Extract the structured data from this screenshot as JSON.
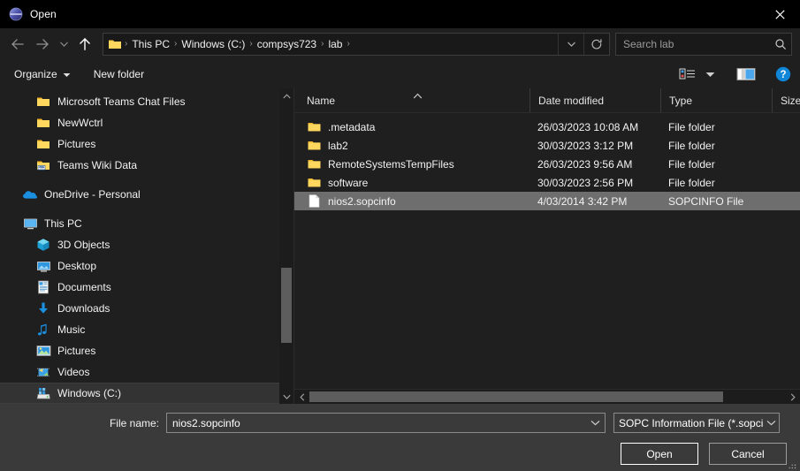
{
  "window": {
    "title": "Open",
    "icon": "quartus-sphere-icon",
    "close_label": "✕"
  },
  "nav": {
    "back": "back-arrow",
    "forward": "forward-arrow",
    "recent": "recent-locations-chevron",
    "up": "up-arrow",
    "breadcrumbs": [
      "This PC",
      "Windows (C:)",
      "compsys723",
      "lab"
    ],
    "separator": "›",
    "history_dropdown": "chevron-down",
    "refresh": "refresh-icon"
  },
  "search": {
    "placeholder": "Search lab"
  },
  "toolbar": {
    "organize_label": "Organize",
    "organize_caret": "▾",
    "new_folder_label": "New folder",
    "view_label": "Change your view",
    "view_caret": "▾",
    "preview_label": "Show the preview pane",
    "help_label": "?"
  },
  "sidebar": {
    "items": [
      {
        "label": "Microsoft Teams Chat Files",
        "icon": "folder-icon",
        "indent": 2,
        "selected": false
      },
      {
        "label": "NewWctrl",
        "icon": "folder-icon",
        "indent": 2,
        "selected": false
      },
      {
        "label": "Pictures",
        "icon": "folder-icon",
        "indent": 2,
        "selected": false
      },
      {
        "label": "Teams Wiki Data",
        "icon": "folder-shortcut-icon",
        "indent": 2,
        "selected": false
      },
      {
        "label": "OneDrive - Personal",
        "icon": "onedrive-cloud-icon",
        "indent": 1,
        "selected": false,
        "gap_before": true
      },
      {
        "label": "This PC",
        "icon": "this-pc-monitor-icon",
        "indent": 1,
        "selected": false,
        "gap_before": true
      },
      {
        "label": "3D Objects",
        "icon": "3d-objects-icon",
        "indent": 2,
        "selected": false
      },
      {
        "label": "Desktop",
        "icon": "desktop-icon",
        "indent": 2,
        "selected": false
      },
      {
        "label": "Documents",
        "icon": "documents-icon",
        "indent": 2,
        "selected": false
      },
      {
        "label": "Downloads",
        "icon": "downloads-arrow-icon",
        "indent": 2,
        "selected": false
      },
      {
        "label": "Music",
        "icon": "music-note-icon",
        "indent": 2,
        "selected": false
      },
      {
        "label": "Pictures",
        "icon": "pictures-icon",
        "indent": 2,
        "selected": false
      },
      {
        "label": "Videos",
        "icon": "videos-icon",
        "indent": 2,
        "selected": false
      },
      {
        "label": "Windows (C:)",
        "icon": "local-disk-icon",
        "indent": 2,
        "selected": true
      }
    ]
  },
  "filelist": {
    "columns": [
      {
        "label": "Name",
        "sorted": "ascending"
      },
      {
        "label": "Date modified",
        "sorted": ""
      },
      {
        "label": "Type",
        "sorted": ""
      },
      {
        "label": "Size",
        "sorted": ""
      }
    ],
    "sort_caret": "⌃",
    "rows": [
      {
        "name": ".metadata",
        "date": "26/03/2023 10:08 AM",
        "type": "File folder",
        "size": "",
        "icon": "folder-icon",
        "selected": false
      },
      {
        "name": "lab2",
        "date": "30/03/2023 3:12 PM",
        "type": "File folder",
        "size": "",
        "icon": "folder-icon",
        "selected": false
      },
      {
        "name": "RemoteSystemsTempFiles",
        "date": "26/03/2023 9:56 AM",
        "type": "File folder",
        "size": "",
        "icon": "folder-icon",
        "selected": false
      },
      {
        "name": "software",
        "date": "30/03/2023 2:56 PM",
        "type": "File folder",
        "size": "",
        "icon": "folder-icon",
        "selected": false
      },
      {
        "name": "nios2.sopcinfo",
        "date": "4/03/2014 3:42 PM",
        "type": "SOPCINFO File",
        "size": "",
        "icon": "document-icon",
        "selected": true
      }
    ]
  },
  "footer": {
    "filename_label": "File name:",
    "filename_value": "nios2.sopcinfo",
    "filetype_value": "SOPC Information File (*.sopcir",
    "open_label": "Open",
    "cancel_label": "Cancel",
    "dropdown_caret": "⌄"
  },
  "colors": {
    "window_bg": "#1f1f1f",
    "titlebar_bg": "#000000",
    "footer_bg": "#3a3a3a",
    "selection_row": "#6e6e6e",
    "selection_nav": "#333333",
    "folder_yellow": "#f6c947",
    "accent_blue": "#0f86d8",
    "text": "#f2f2f2"
  }
}
